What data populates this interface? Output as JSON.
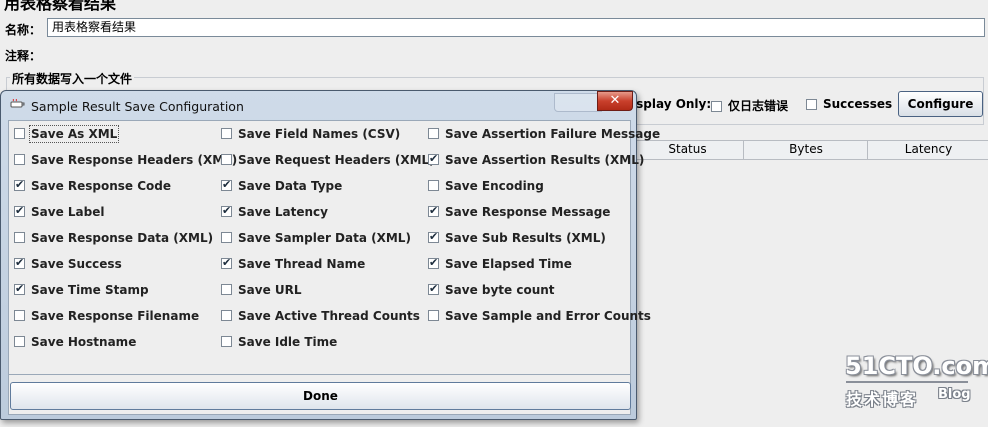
{
  "panel": {
    "title": "用表格察看结果",
    "name_label": "名称：",
    "name_value": "用表格察看结果",
    "comment_label": "注释：",
    "file_group_title": "所有数据写入一个文件",
    "display_only_label": "isplay Only:",
    "errors_only_label": "仅日志错误",
    "successes_label": "Successes",
    "configure_label": "Configure",
    "columns": [
      "Status",
      "Bytes",
      "Latency"
    ]
  },
  "dialog": {
    "title": "Sample Result Save Configuration",
    "close_glyph": "✕",
    "options": [
      [
        {
          "label": "Save As XML",
          "checked": false
        },
        {
          "label": "Save Response Headers (XML)",
          "checked": false
        },
        {
          "label": "Save Response Code",
          "checked": true
        },
        {
          "label": "Save Label",
          "checked": true
        },
        {
          "label": "Save Response Data (XML)",
          "checked": false
        },
        {
          "label": "Save Success",
          "checked": true
        },
        {
          "label": "Save Time Stamp",
          "checked": true
        },
        {
          "label": "Save Response Filename",
          "checked": false
        },
        {
          "label": "Save Hostname",
          "checked": false
        }
      ],
      [
        {
          "label": "Save Field Names (CSV)",
          "checked": false
        },
        {
          "label": "Save Request Headers (XML)",
          "checked": false
        },
        {
          "label": "Save Data Type",
          "checked": true
        },
        {
          "label": "Save Latency",
          "checked": true
        },
        {
          "label": "Save Sampler Data (XML)",
          "checked": false
        },
        {
          "label": "Save Thread Name",
          "checked": true
        },
        {
          "label": "Save URL",
          "checked": false
        },
        {
          "label": "Save Active Thread Counts",
          "checked": false
        },
        {
          "label": "Save Idle Time",
          "checked": false
        }
      ],
      [
        {
          "label": "Save Assertion Failure Message",
          "checked": false
        },
        {
          "label": "Save Assertion Results (XML)",
          "checked": true
        },
        {
          "label": "Save Encoding",
          "checked": false
        },
        {
          "label": "Save Response Message",
          "checked": true
        },
        {
          "label": "Save Sub Results (XML)",
          "checked": true
        },
        {
          "label": "Save Elapsed Time",
          "checked": true
        },
        {
          "label": "Save byte count",
          "checked": true
        },
        {
          "label": "Save Sample and Error Counts",
          "checked": false
        }
      ]
    ],
    "done_label": "Done"
  },
  "watermark": {
    "site": "51CTO.com",
    "tagline": "技术博客",
    "blog": "Blog"
  },
  "colors": {
    "dialog_frame": "#bccbdc",
    "close_button": "#c9402c",
    "background": "#eeeeee"
  }
}
